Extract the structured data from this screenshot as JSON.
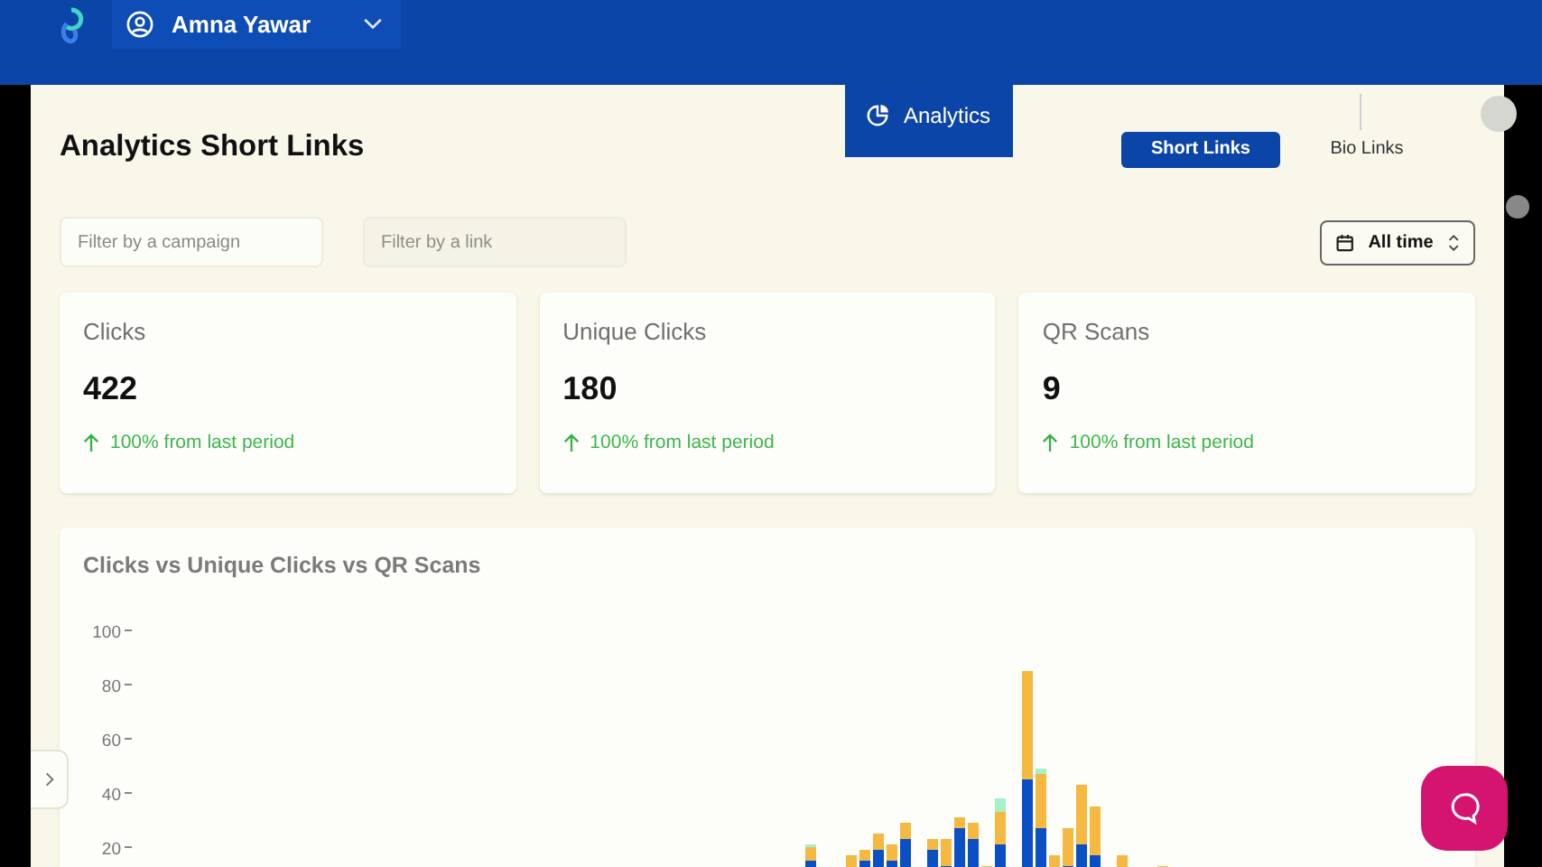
{
  "header": {
    "user": {
      "name": "Amna Yawar"
    },
    "nav_tab": {
      "label": "Analytics",
      "selected": true
    }
  },
  "page": {
    "title": "Analytics Short Links"
  },
  "link_types": [
    {
      "label": "Short Links",
      "selected": true
    },
    {
      "label": "Bio Links",
      "selected": false
    }
  ],
  "filters": [
    {
      "placeholder": "Filter by a campaign",
      "disabled": false
    },
    {
      "placeholder": "Filter by a link",
      "disabled": true
    }
  ],
  "period": {
    "value": "All time"
  },
  "stats": [
    {
      "label": "Clicks",
      "value": "422",
      "change": "100% from last period"
    },
    {
      "label": "Unique Clicks",
      "value": "180",
      "change": "100% from last period"
    },
    {
      "label": "QR Scans",
      "value": "9",
      "change": "100% from last period"
    }
  ],
  "chart": {
    "title": "Clicks vs Unique Clicks vs QR Scans",
    "y_axis_labels": [
      "100",
      "80",
      "60",
      "40",
      "20"
    ]
  }
}
